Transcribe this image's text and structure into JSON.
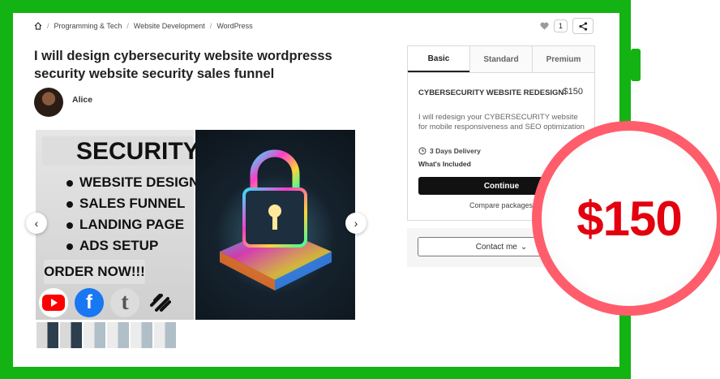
{
  "breadcrumb": {
    "items": [
      "Programming & Tech",
      "Website Development",
      "WordPress"
    ]
  },
  "actions": {
    "like_count": "1"
  },
  "gig": {
    "title": "I will design cybersecurity website wordpresss security website security sales funnel",
    "seller_name": "Alice"
  },
  "gallery": {
    "heading": "SECURITY",
    "bullets": [
      "WEBSITE DESIGN",
      "SALES FUNNEL",
      "LANDING  PAGE",
      "ADS SETUP"
    ],
    "cta": "ORDER NOW!!!",
    "social_icons": [
      "youtube-icon",
      "facebook-icon",
      "tumblr-icon",
      "squarespace-icon"
    ]
  },
  "package": {
    "tabs": [
      "Basic",
      "Standard",
      "Premium"
    ],
    "name": "CYBERSECURITY WEBSITE REDESIGN",
    "price": "$150",
    "description": "I will redesign your CYBERSECURITY website for mobile responsiveness and SEO optimization",
    "delivery": "3 Days Delivery",
    "included_label": "What's Included",
    "continue_label": "Continue",
    "compare_label": "Compare packages"
  },
  "contact": {
    "label": "Contact me"
  },
  "badge": {
    "price": "$150"
  },
  "colors": {
    "frame_green": "#12b313",
    "badge_ring": "#ff5d6c",
    "badge_text": "#e3000f"
  }
}
